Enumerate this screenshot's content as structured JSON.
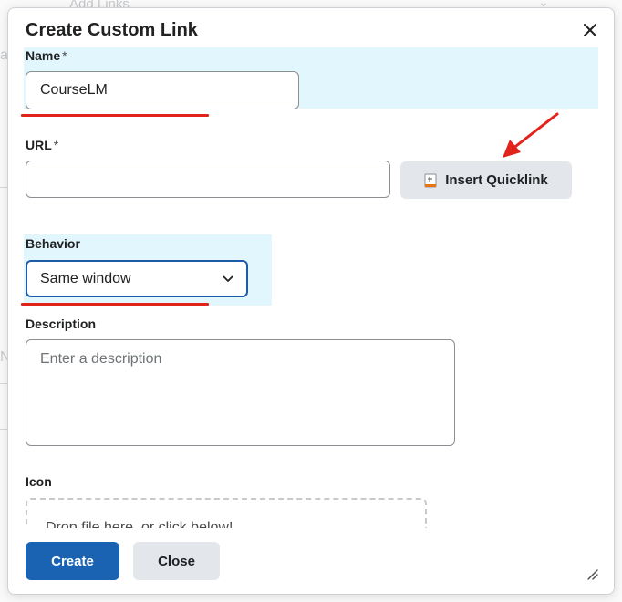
{
  "background": {
    "peek_title": "Add Links",
    "peek_letter_a": "a",
    "peek_letter_n": "N"
  },
  "dialog": {
    "title": "Create Custom Link",
    "close_icon": "close-icon",
    "name": {
      "label": "Name",
      "required_mark": "*",
      "value": "CourseLM"
    },
    "url": {
      "label": "URL",
      "required_mark": "*",
      "value": ""
    },
    "quicklink": {
      "label": "Insert Quicklink",
      "icon": "quicklink-icon"
    },
    "behavior": {
      "label": "Behavior",
      "selected": "Same window",
      "icon": "chevron-down-icon"
    },
    "description": {
      "label": "Description",
      "placeholder": "Enter a description"
    },
    "icon": {
      "label": "Icon",
      "dropzone_text": "Drop file here, or click below!"
    },
    "footer": {
      "create_label": "Create",
      "close_label": "Close"
    }
  },
  "colors": {
    "primary": "#1a63b3",
    "highlight": "#e2f6fe",
    "annotation_red": "#e2231a",
    "focus_border": "#1f5ca8"
  }
}
